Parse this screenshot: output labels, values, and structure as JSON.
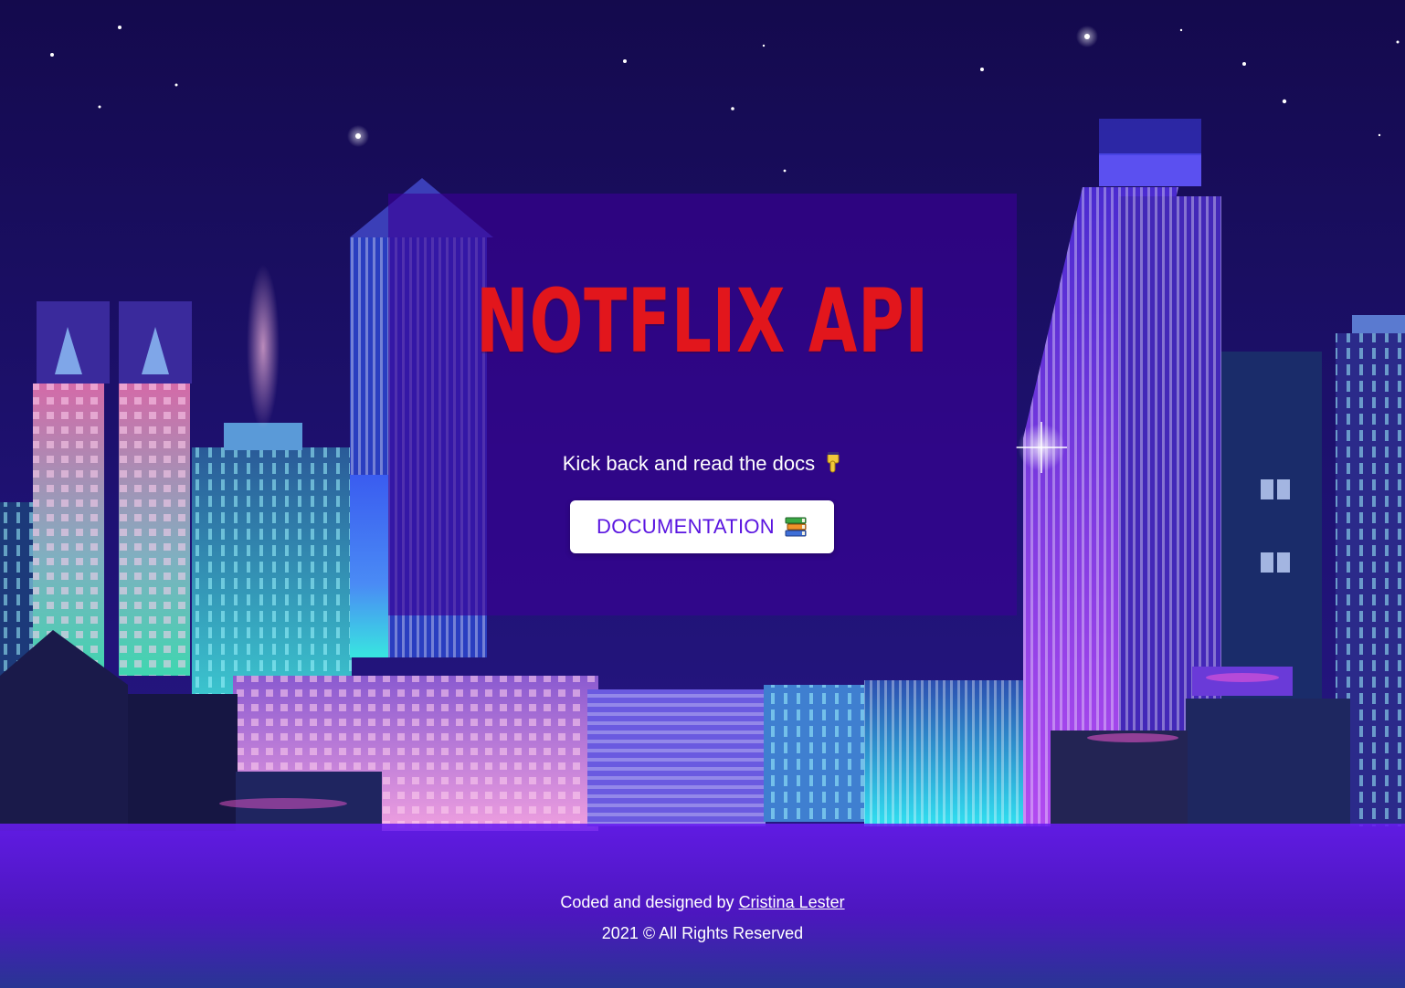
{
  "hero": {
    "title": "NOTFLIX API",
    "subtitle": "Kick back and read the docs",
    "subtitle_icon": "pointing-down-hand-icon",
    "button_label": "DOCUMENTATION",
    "button_icon": "books-icon"
  },
  "footer": {
    "credit_prefix": "Coded and designed by",
    "author": "Cristina Lester",
    "copyright": "2021 © All Rights Reserved"
  },
  "colors": {
    "brand_red": "#e2161c",
    "button_text": "#5a15e0",
    "card_overlay": "#3a0096",
    "footer_purple": "#6a1cf0"
  }
}
